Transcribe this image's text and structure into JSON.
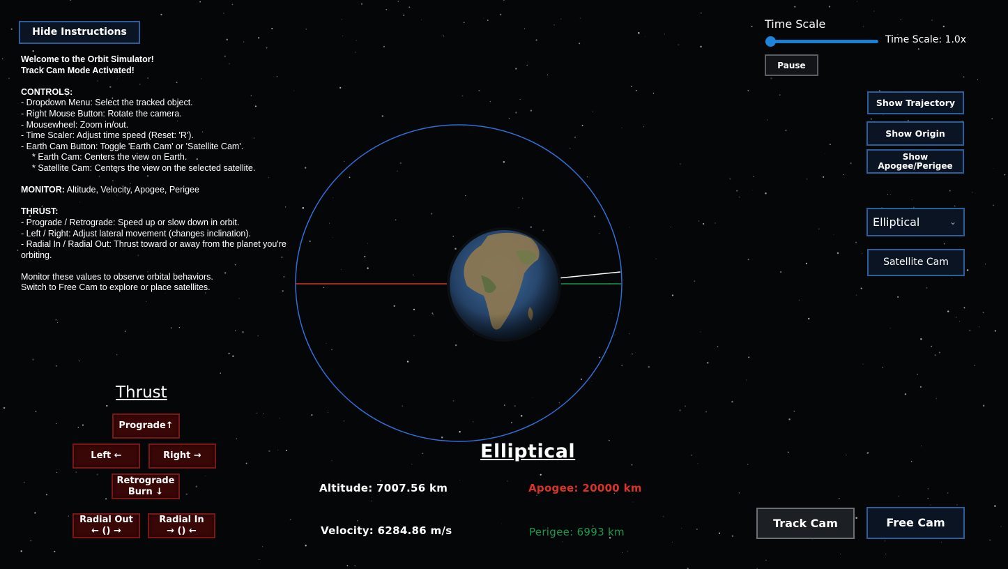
{
  "instructions_toggle_label": "Hide Instructions",
  "instructions": {
    "welcome": "Welcome to the Orbit Simulator!",
    "mode": "Track Cam Mode Activated!",
    "controls_heading": "CONTROLS:",
    "controls": [
      "- Dropdown Menu: Select the tracked object.",
      "- Right Mouse Button: Rotate the camera.",
      "- Mousewheel: Zoom in/out.",
      "- Time Scaler: Adjust time speed (Reset: 'R').",
      "- Earth Cam Button: Toggle 'Earth Cam' or 'Satellite Cam'."
    ],
    "cam_notes": [
      "* Earth Cam: Centers the view on Earth.",
      "* Satellite Cam: Centers the view on the selected satellite."
    ],
    "monitor_heading": "MONITOR:",
    "monitor_text": " Altitude, Velocity, Apogee, Perigee",
    "thrust_heading": "THRUST:",
    "thrust_lines": [
      "- Prograde / Retrograde: Speed up or slow down in orbit.",
      "- Left / Right: Adjust lateral movement (changes inclination).",
      "- Radial In / Radial Out: Thrust toward or away from the planet you're orbiting."
    ],
    "footer": [
      "Monitor these values to observe orbital behaviors.",
      "Switch to Free Cam to explore or place satellites."
    ]
  },
  "time_scale": {
    "title": "Time Scale",
    "readout": "Time Scale: 1.0x",
    "slider_fraction": 0.0,
    "pause_label": "Pause"
  },
  "right_panel": {
    "show_trajectory": "Show Trajectory",
    "show_origin": "Show Origin",
    "show_apogee_perigee": "Show Apogee/Perigee",
    "orbit_select_value": "Elliptical",
    "satellite_cam": "Satellite Cam"
  },
  "thrust_panel": {
    "title": "Thrust",
    "prograde": "Prograde↑",
    "left": "Left ←",
    "right": "Right →",
    "retrograde": "Retrograde\nBurn ↓",
    "radial_out": "Radial Out\n← () →",
    "radial_in": "Radial In\n→ () ←"
  },
  "orbit_info": {
    "title": "Elliptical",
    "altitude": "Altitude: 7007.56 km",
    "velocity": "Velocity: 6284.86 m/s",
    "apogee": "Apogee: 20000 km",
    "perigee": "Perigee: 6993 km"
  },
  "camera_buttons": {
    "track_cam": "Track Cam",
    "free_cam": "Free Cam"
  },
  "colors": {
    "orbit_line": "#2f6fd8",
    "apogee": "#d8342c",
    "perigee": "#1a9a4e",
    "button_blue_border": "#2a5f9c",
    "button_red_bg": "#3a0707"
  }
}
